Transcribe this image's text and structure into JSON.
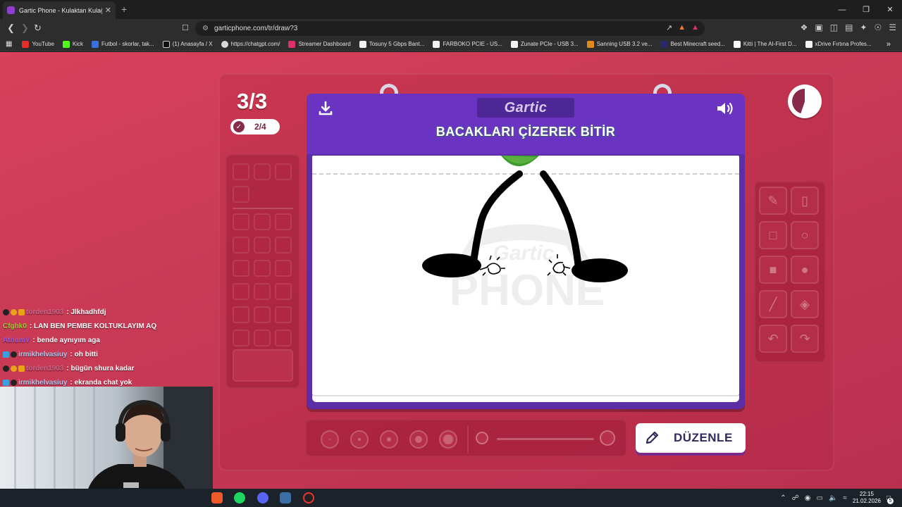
{
  "browser": {
    "tab_title": "Gartic Phone - Kulaktan Kulağa",
    "tab_close": "✕",
    "new_tab": "+",
    "url": "garticphone.com/tr/draw?3",
    "window_controls": {
      "minimize": "—",
      "restore": "❐",
      "close": "✕"
    },
    "bookmarks": [
      {
        "label": "YouTube",
        "color": "#e52d27"
      },
      {
        "label": "Kick",
        "color": "#53fc18"
      },
      {
        "label": "Futbol - skorlar, tak...",
        "color": "#3b6fe0"
      },
      {
        "label": "(1) Anasayfa / X",
        "color": "#ffffff"
      },
      {
        "label": "https://chatgpt.com/",
        "color": "#d9d9d9"
      },
      {
        "label": "Streamer Dashboard",
        "color": "#e0306a"
      },
      {
        "label": "Tosuny 5 Gbps Bant...",
        "color": "#f2f2f2"
      },
      {
        "label": "FARBOKO PCIE - US...",
        "color": "#f2f2f2"
      },
      {
        "label": "Zunate PCIe - USB 3...",
        "color": "#f2f2f2"
      },
      {
        "label": "Sanning USB 3.2 ve...",
        "color": "#e08a1e"
      },
      {
        "label": "Best Minecraft seed...",
        "color": "#2a2a6a"
      },
      {
        "label": "Kitti | The AI-First D...",
        "color": "#ffffff"
      },
      {
        "label": "xDrive Fırtına Profes...",
        "color": "#f2f2f2"
      }
    ]
  },
  "game": {
    "round": "3/3",
    "done_count": "2/4",
    "logo": "Gartic",
    "instruction": "BACAKLARI ÇİZEREK BİTİR",
    "watermark_line1": "Gartic",
    "watermark_line2": "PHONE",
    "edit_label": "DÜZENLE",
    "timer_remaining_fraction": 0.45
  },
  "chat": [
    {
      "user": "torden1903",
      "user_color": "#c86a8a",
      "message": ": Jlkhadhfdj",
      "badges": [
        "#222",
        "#e8a317",
        "#e8a317"
      ]
    },
    {
      "user": "Cfghk0",
      "user_color": "#9acd32",
      "message": ": LAN BEN PEMBE KOLTUKLAYIM AQ",
      "badges": []
    },
    {
      "user": "AthumV",
      "user_color": "#9a5ad8",
      "message": ": bende aynıyım aga",
      "badges": []
    },
    {
      "user": "irmikhelvasiuy",
      "user_color": "#a9c9f0",
      "message": ": oh bitti",
      "badges": [
        "#3aa0e0",
        "#222"
      ]
    },
    {
      "user": "torden1903",
      "user_color": "#c86a8a",
      "message": ": bügün shura kadar",
      "badges": [
        "#222",
        "#e8a317",
        "#e8a317"
      ]
    },
    {
      "user": "irmikhelvasiuy",
      "user_color": "#a9c9f0",
      "message": ": ekranda chat yok",
      "badges": [
        "#3aa0e0",
        "#222"
      ]
    }
  ],
  "taskbar": {
    "time": "22:15",
    "date": "21.02.2026",
    "notifications": "5"
  }
}
